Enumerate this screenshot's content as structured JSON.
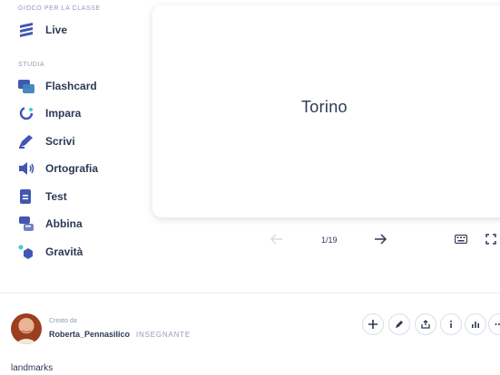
{
  "sidebar": {
    "section_live": "GIOCO PER LA CLASSE",
    "live_label": "Live",
    "section_study": "STUDIA",
    "modes": [
      {
        "label": "Flashcard",
        "icon": "flashcards-icon"
      },
      {
        "label": "Impara",
        "icon": "learn-icon"
      },
      {
        "label": "Scrivi",
        "icon": "write-icon"
      },
      {
        "label": "Ortografia",
        "icon": "spell-icon"
      },
      {
        "label": "Test",
        "icon": "test-icon"
      },
      {
        "label": "Abbina",
        "icon": "match-icon"
      },
      {
        "label": "Gravità",
        "icon": "gravity-icon"
      }
    ]
  },
  "card": {
    "term": "Torino"
  },
  "navigation": {
    "counter": "1/19"
  },
  "creator": {
    "caption": "Creato da",
    "name": "Roberta_Pennasilico",
    "role": "INSEGNANTE"
  },
  "footer": {
    "text": "landmarks"
  },
  "colors": {
    "accent": "#4257b2",
    "text": "#2e3856",
    "muted": "#939bb4"
  }
}
